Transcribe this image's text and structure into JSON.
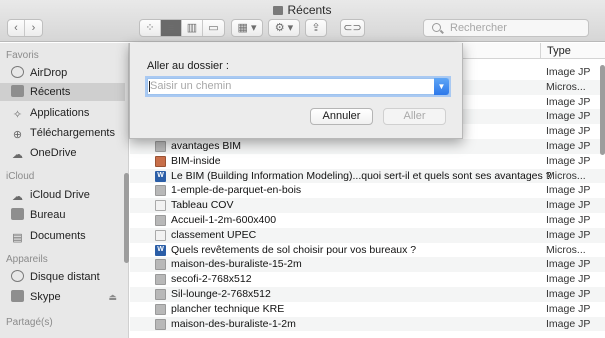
{
  "window": {
    "title": "Récents"
  },
  "toolbar": {
    "back_icon": "chevron-left-icon",
    "forward_icon": "chevron-right-icon",
    "view_icons": [
      "icon-view-icon",
      "list-view-icon",
      "column-view-icon",
      "cover-flow-icon"
    ],
    "group_icon": "group-grid-icon",
    "action_icon": "gear-icon",
    "share_icon": "share-icon",
    "tag_icon": "tag-icon",
    "search_placeholder": "Rechercher"
  },
  "sidebar": {
    "sections": [
      {
        "title": "Favoris"
      },
      {
        "title": "iCloud"
      },
      {
        "title": "Appareils"
      },
      {
        "title": "Partagé(s)"
      }
    ],
    "favoris": [
      {
        "label": "AirDrop",
        "icon": "airdrop-icon"
      },
      {
        "label": "Récents",
        "icon": "recents-icon",
        "selected": true
      },
      {
        "label": "Applications",
        "icon": "applications-icon"
      },
      {
        "label": "Téléchargements",
        "icon": "downloads-icon"
      },
      {
        "label": "OneDrive",
        "icon": "cloud-icon"
      }
    ],
    "icloud": [
      {
        "label": "iCloud Drive",
        "icon": "icloud-icon"
      },
      {
        "label": "Bureau",
        "icon": "desktop-icon"
      },
      {
        "label": "Documents",
        "icon": "documents-icon"
      }
    ],
    "appareils": [
      {
        "label": "Disque distant",
        "icon": "disk-icon"
      },
      {
        "label": "Skype",
        "icon": "drive-icon"
      }
    ]
  },
  "list": {
    "columns": {
      "type": "Type"
    },
    "rows": [
      {
        "name": "",
        "type": "Image JP"
      },
      {
        "name": "",
        "type": "Micros..."
      },
      {
        "name": "",
        "type": "Image JP"
      },
      {
        "name": "",
        "type": "Image JP"
      },
      {
        "name": "",
        "type": "Image JP"
      },
      {
        "name": "avantages BIM",
        "type": "Image JP",
        "icon": "img"
      },
      {
        "name": "BIM-inside",
        "type": "Image JP",
        "icon": "pic"
      },
      {
        "name": "Le BIM (Building Information Modeling)...quoi sert-il et quels sont ses avantages ?",
        "type": "Micros...",
        "icon": "doc"
      },
      {
        "name": "1-emple-de-parquet-en-bois",
        "type": "Image JP",
        "icon": "img"
      },
      {
        "name": "Tableau COV",
        "type": "Image JP",
        "icon": "plain"
      },
      {
        "name": "Accueil-1-2m-600x400",
        "type": "Image JP",
        "icon": "img"
      },
      {
        "name": "classement UPEC",
        "type": "Image JP",
        "icon": "plain"
      },
      {
        "name": "Quels revêtements de sol choisir pour vos bureaux ?",
        "type": "Micros...",
        "icon": "doc"
      },
      {
        "name": "maison-des-buraliste-15-2m",
        "type": "Image JP",
        "icon": "img"
      },
      {
        "name": "secofi-2-768x512",
        "type": "Image JP",
        "icon": "img"
      },
      {
        "name": "Sil-lounge-2-768x512",
        "type": "Image JP",
        "icon": "img"
      },
      {
        "name": "plancher technique KRE",
        "type": "Image JP",
        "icon": "img"
      },
      {
        "name": "maison-des-buraliste-1-2m",
        "type": "Image JP",
        "icon": "img"
      }
    ]
  },
  "dialog": {
    "title": "Aller au dossier :",
    "input_placeholder": "Saisir un chemin",
    "input_value": "",
    "cancel_label": "Annuler",
    "go_label": "Aller"
  }
}
